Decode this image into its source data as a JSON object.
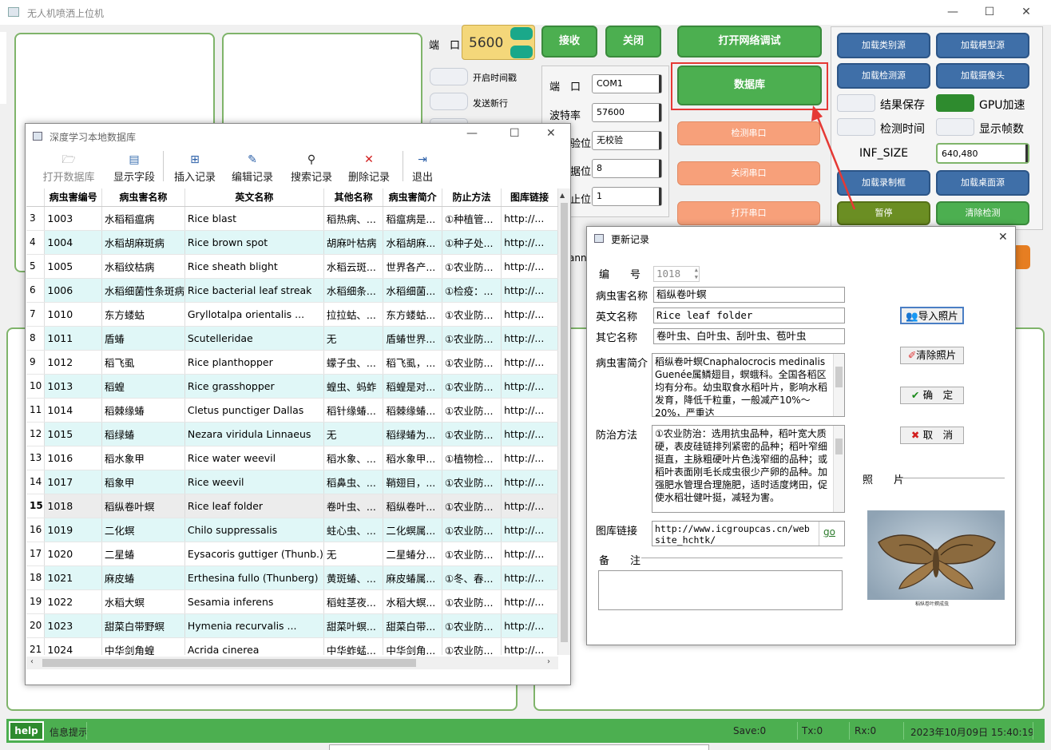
{
  "window": {
    "title": "无人机喷洒上位机",
    "min": "—",
    "max": "☐",
    "close": "✕"
  },
  "top": {
    "port_label": "端　口",
    "port_value": "5600",
    "receive_btn": "接收",
    "close_btn": "关闭",
    "net_debug_btn": "打开网络调试",
    "database_btn": "数据库",
    "toggle_timestamp": "开启时间戳",
    "toggle_newline": "发送新行",
    "serial": {
      "port_label": "端　口",
      "port_value": "COM1",
      "baud_label": "波特率",
      "baud_value": "57600",
      "parity_label": "验位",
      "parity_value": "无校验",
      "databits_label": "据位",
      "databits_value": "8",
      "stopbits_label": "止位",
      "stopbits_value": "1"
    },
    "detect_serial_btn": "检测串口",
    "close_serial_btn": "关闭串口",
    "open_serial_btn": "打开串口",
    "load_class_btn": "加载类别源",
    "load_model_btn": "加载模型源",
    "load_detect_btn": "加载检测源",
    "load_camera_btn": "加载摄像头",
    "save_result": "结果保存",
    "gpu_accel": "GPU加速",
    "detect_time": "检测时间",
    "show_fps": "显示帧数",
    "inf_size_label": "INF_SIZE",
    "inf_size_value": "640,480",
    "load_record_btn": "加载录制框",
    "load_desktop_btn": "加载桌面源",
    "pause_btn": "暂停",
    "clear_detect_btn": "清除检测",
    "partial_label": "anne"
  },
  "db": {
    "title": "深度学习本地数据库",
    "toolbar": [
      "打开数据库",
      "显示字段",
      "插入记录",
      "编辑记录",
      "搜索记录",
      "删除记录",
      "退出"
    ],
    "columns": [
      "病虫害编号",
      "病虫害名称",
      "英文名称",
      "其他名称",
      "病虫害简介",
      "防止方法",
      "图库链接"
    ],
    "rows": [
      [
        "3",
        "1003",
        "水稻稻瘟病",
        "Rice blast",
        "稻热病、...",
        "稻瘟病是...",
        "①种植管...",
        "http://..."
      ],
      [
        "4",
        "1004",
        "水稻胡麻斑病",
        "Rice brown spot",
        "胡麻叶枯病",
        "水稻胡麻...",
        "①种子处...",
        "http://..."
      ],
      [
        "5",
        "1005",
        "水稻纹枯病",
        "Rice sheath blight",
        "水稻云斑...",
        "世界各产...",
        "①农业防...",
        "http://..."
      ],
      [
        "6",
        "1006",
        "水稻细菌性条斑病",
        "Rice bacterial leaf streak",
        "水稻细条...",
        "水稻细菌...",
        "①检疫：...",
        "http://..."
      ],
      [
        "7",
        "1010",
        "东方蝼蛄",
        "Gryllotalpa orientalis ...",
        "拉拉蛄、...",
        "东方蝼蛄...",
        "①农业防...",
        "http://..."
      ],
      [
        "8",
        "1011",
        "盾蝽",
        "Scutelleridae",
        "无",
        "盾蝽世界...",
        "①农业防...",
        "http://..."
      ],
      [
        "9",
        "1012",
        "稻飞虱",
        "Rice planthopper",
        "蠓子虫、...",
        "稻飞虱，...",
        "①农业防...",
        "http://..."
      ],
      [
        "10",
        "1013",
        "稻蝗",
        "Rice grasshopper",
        "蝗虫、蚂蚱",
        "稻蝗是对...",
        "①农业防...",
        "http://..."
      ],
      [
        "11",
        "1014",
        "稻棘缘蝽",
        "Cletus punctiger Dallas",
        "稻针缘蝽...",
        "稻棘缘蝽...",
        "①农业防...",
        "http://..."
      ],
      [
        "12",
        "1015",
        "稻绿蝽",
        "Nezara viridula Linnaeus",
        "无",
        "稻绿蝽为...",
        "①农业防...",
        "http://..."
      ],
      [
        "13",
        "1016",
        "稻水象甲",
        "Rice water weevil",
        "稻水象、...",
        "稻水象甲...",
        "①植物检...",
        "http://..."
      ],
      [
        "14",
        "1017",
        "稻象甲",
        "Rice weevil",
        "稻鼻虫、...",
        "鞘翅目，...",
        "①农业防...",
        "http://..."
      ],
      [
        "15",
        "1018",
        "稻纵卷叶螟",
        "Rice leaf folder",
        "卷叶虫、...",
        "稻纵卷叶...",
        "①农业防...",
        "http://..."
      ],
      [
        "16",
        "1019",
        "二化螟",
        "Chilo suppressalis",
        "蛀心虫、...",
        "二化螟属...",
        "①农业防...",
        "http://..."
      ],
      [
        "17",
        "1020",
        "二星蝽",
        "Eysacoris guttiger (Thunb.)",
        "无",
        "二星蝽分...",
        "①农业防...",
        "http://..."
      ],
      [
        "18",
        "1021",
        "麻皮蝽",
        "Erthesina fullo (Thunberg)",
        "黄斑蝽、...",
        "麻皮蝽属...",
        "①冬、春...",
        "http://..."
      ],
      [
        "19",
        "1022",
        "水稻大螟",
        "Sesamia inferens",
        "稻蛀茎夜...",
        "水稻大螟...",
        "①农业防...",
        "http://..."
      ],
      [
        "20",
        "1023",
        "甜菜白带野螟",
        "Hymenia recurvalis ...",
        "甜菜叶螟...",
        "甜菜白带...",
        "①农业防...",
        "http://..."
      ],
      [
        "21",
        "1024",
        "中华剑角蝗",
        "Acrida cinerea",
        "中华蚱蜢...",
        "中华剑角...",
        "①农业防...",
        "http://..."
      ]
    ]
  },
  "edit": {
    "title": "更新记录",
    "id_label": "编　　号",
    "id_value": "1018",
    "name_label": "病虫害名称",
    "name_value": "稻纵卷叶螟",
    "en_label": "英文名称",
    "en_value": "Rice leaf folder",
    "other_label": "其它名称",
    "other_value": "卷叶虫、白叶虫、刮叶虫、苞叶虫",
    "intro_label": "病虫害简介",
    "intro_value": "稻纵卷叶螟Cnaphalocrocis medinalis Guenée属鳞翅目，螟蛾科。全国各稻区均有分布。幼虫取食水稻叶片，影响水稻发育，降低千粒重，一般减产10%～20%，严重达",
    "method_label": "防治方法",
    "method_value": "①农业防治：选用抗虫品种，稻叶宽大质硬，表皮硅链排列紧密的品种；稻叶窄细挺直，主脉粗硬叶片色浅窄细的品种；或稻叶表面刚毛长成虫很少产卵的品种。加强肥水管理合理施肥，适时适度烤田，促使水稻壮健叶挺，减轻为害。",
    "link_label": "图库链接",
    "link_value": "http://www.icgroupcas.cn/website_hchtk/",
    "go": "go",
    "note_label": "备　　注",
    "photo_label": "照　　片",
    "import_btn": "导入照片",
    "clear_btn": "清除照片",
    "ok_btn": "确　定",
    "cancel_btn": "取　消",
    "photo_caption": "稻纵卷叶螟成虫"
  },
  "status": {
    "help": "help",
    "info": "信息提示",
    "save": "Save:0",
    "tx": "Tx:0",
    "rx": "Rx:0",
    "time": "2023年10月09日 15:40:19"
  }
}
